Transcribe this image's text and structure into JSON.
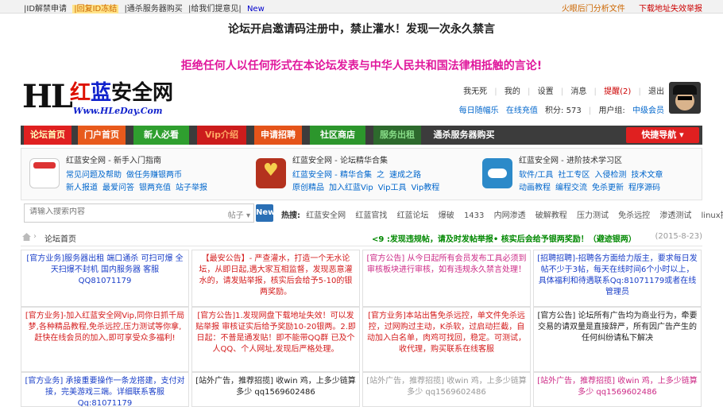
{
  "topbar": {
    "left": [
      "|ID解禁申请",
      "|回复ID冻结",
      "|通杀服务器购买",
      "|给我们提意见|",
      "New"
    ],
    "right": [
      "火眼后门分析文件",
      "下载地址失效举报"
    ]
  },
  "notice": {
    "line1": "论坛开启邀请码注册中，禁止灌水！发现一次永久禁言",
    "line2": "拒绝任何人以任何形式在本论坛发表与中华人民共和国法律相抵触的言论!"
  },
  "logo": {
    "hl": "HL",
    "cn_red": "红",
    "cn_blue": "蓝",
    "cn_black": "安全网",
    "www": "Www.HLeDay.Com"
  },
  "user": {
    "name": "我无死",
    "mine": "我的",
    "settings": "设置",
    "messages": "消息",
    "alerts": "提醒(2)",
    "logout": "退出",
    "checkin": "每日随幅乐",
    "online": "在线充值",
    "points": "积分: 573",
    "group": "用户组:",
    "group_value": "中级会员"
  },
  "nav": {
    "items": [
      "论坛首页",
      "门户首页",
      "新人必看",
      "Vip介绍",
      "申请招聘",
      "社区商店",
      "服务出租",
      "通杀服务器购买"
    ],
    "quick": "快捷导航"
  },
  "features": [
    {
      "title": "红蓝安全网 - 新手入门指南",
      "line1": [
        "常见问题及帮助",
        "做任务赚银两币"
      ],
      "line2": [
        "新人报道",
        "最爱问答",
        "银两充值",
        "站子举报"
      ]
    },
    {
      "title": "红蓝安全网 - 论坛精华合集",
      "line1": [
        "红蓝安全网 - 精华合集",
        "之",
        "速成之路"
      ],
      "line2": [
        "原创精品",
        "加入红蓝Vip",
        "Vip工具",
        "Vip教程"
      ]
    },
    {
      "title": "红蓝安全网 - 进阶技术学习区",
      "line1": [
        "软件/工具",
        "社工专区",
        "入侵检测",
        "技术文章"
      ],
      "line2": [
        "动画教程",
        "编程交流",
        "免杀更新",
        "程序源码"
      ]
    }
  ],
  "search": {
    "placeholder": "请输入搜索内容",
    "scope": "帖子",
    "button": "New",
    "hot_label": "热搜:",
    "hot": [
      "红蓝安全网",
      "红蓝官找",
      "红蓝论坛",
      "爆破",
      "1433",
      "内网渗透",
      "破解教程",
      "压力测试",
      "免杀远控",
      "渗透测试",
      "linux提权"
    ]
  },
  "breadcrumb": {
    "separator": "›",
    "current": "论坛首页",
    "marquee": "<9 :发现违规帖，请及时发帖举报• 核实后会给予银两奖励！（避迹银两）",
    "date": "(2015-8-23)"
  },
  "grid": [
    {
      "cls": "c-blue",
      "text": "[官方业务]服务器出租 端口通杀 可扫可爆 全天扫爆不封机 国内服务器 客服 QQ81071179"
    },
    {
      "cls": "c-red",
      "text": "【最安公告】- 严查灌水，打造一个无水论坛，从即日起,遇大家互相监督，发现恶意灌水的，请发贴举报，核实后会给予5-10的银两奖励。"
    },
    {
      "cls": "c-pink",
      "text": "[官方公告] 从今日起所有会员发布工具必须到审核板块进行审核，如有违规永久禁言处理！"
    },
    {
      "cls": "c-blue",
      "text": "[招聘招聘]-招聘各方面给力版主，要求每日发帖不少于3帖，每天在线时间6个小时以上，具体福利和待遇联系Qq:81071179或者在线管理员"
    },
    {
      "cls": "c-red",
      "text": "[官方业务]-加入红蓝安全网Vip,同你日抓千局梦,各种精品教程,免杀远控,压力测试等你拿,赶快在线会员的加入,即可享受众多福利!"
    },
    {
      "cls": "c-red",
      "text": "[官方公告]1.发现网盘下载地址失效！可以发贴举报 审核证实后给予奖励10-20银两。2.即日起：不普是通发贴！即不能带QQ群 已及个人QQ、个人网址,发现后严格处理。"
    },
    {
      "cls": "c-red",
      "text": "[官方业务]本站出售免杀远控，单文件免杀远控，过网购过主动，K杀软，过启动拦截，自动加入白名单，肉鸡可找回，稳定。可测试，收代理，购买联系在线客服"
    },
    {
      "cls": "c-dark",
      "text": "[官方公告] 论坛所有广告均为商业行为，牵要交易的请双量是直接辞严，所有因广告产生的任何纠纷请私下解决"
    },
    {
      "cls": "c-blue",
      "text": "[官方业务] 承接重要操作一条龙搭建，支付对接，完美游戏三端。详细联系客服Qq:81071179"
    },
    {
      "cls": "c-dark",
      "text": "[站外广告，推荐招揽] 收win 鸡，上多少链算多少 qq1569602486"
    },
    {
      "cls": "c-gray",
      "text": "[站外广告，推荐招揽] 收win 鸡，上多少链算多少 qq1569602486"
    },
    {
      "cls": "c-pink",
      "text": "[站外广告，推荐招揽] 收win 鸡，上多少链算多少 qq1569602486"
    }
  ]
}
